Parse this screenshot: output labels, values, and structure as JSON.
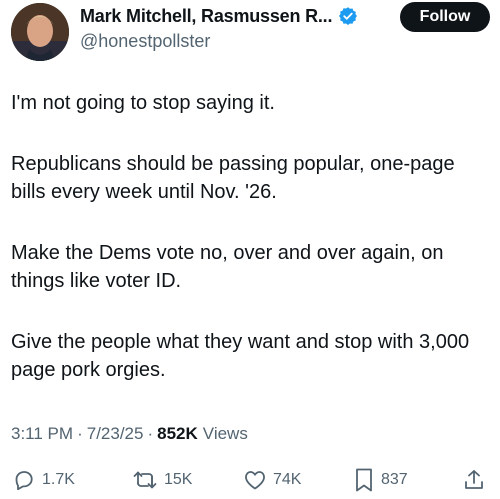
{
  "author": {
    "display_name": "Mark Mitchell, Rasmussen R...",
    "handle": "@honestpollster"
  },
  "follow_label": "Follow",
  "tweet": {
    "paragraphs": [
      "I'm not going to stop saying it.",
      "Republicans should be passing popular, one-page bills every week until Nov. '26.",
      "Make the Dems vote no, over and over again, on things like voter ID.",
      "Give the people what they want and stop with 3,000 page pork orgies."
    ]
  },
  "meta": {
    "time": "3:11 PM",
    "separator": "·",
    "date": "7/23/25",
    "views_count": "852K",
    "views_label": "Views"
  },
  "actions": {
    "replies": "1.7K",
    "reposts": "15K",
    "likes": "74K",
    "bookmarks": "837"
  },
  "colors": {
    "text": "#0f1419",
    "secondary": "#536471",
    "verified": "#1d9bf0",
    "follow_bg": "#0f1419"
  },
  "icons": [
    "verified-badge-icon",
    "reply-icon",
    "repost-icon",
    "like-icon",
    "bookmark-icon",
    "share-icon"
  ]
}
